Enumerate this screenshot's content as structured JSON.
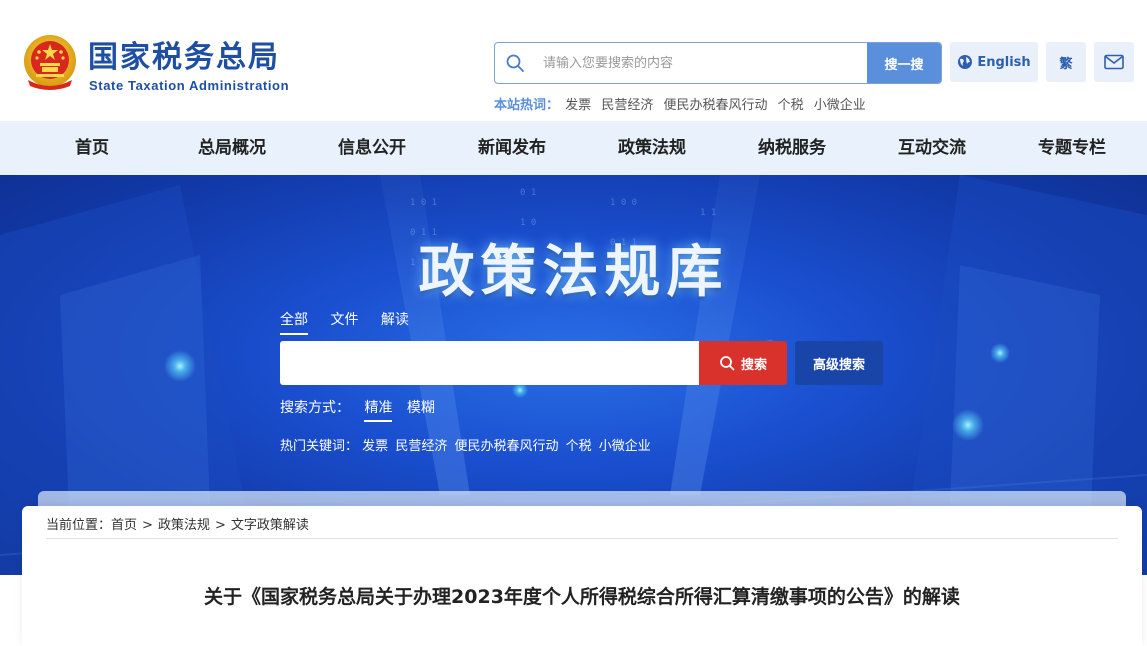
{
  "header": {
    "logo_cn": "国家税务总局",
    "logo_en": "State Taxation Administration",
    "search": {
      "placeholder": "请输入您要搜索的内容",
      "button": "搜一搜"
    },
    "english_label": "English",
    "traditional_label": "繁",
    "hot_label": "本站热词：",
    "hot_words": [
      "发票",
      "民营经济",
      "便民办税春风行动",
      "个税",
      "小微企业"
    ]
  },
  "nav": {
    "items": [
      "首页",
      "总局概况",
      "信息公开",
      "新闻发布",
      "政策法规",
      "纳税服务",
      "互动交流",
      "专题专栏"
    ]
  },
  "banner": {
    "title": "政策法规库",
    "tabs": [
      "全部",
      "文件",
      "解读"
    ],
    "search_button": "搜索",
    "advanced_button": "高级搜索",
    "mode_label": "搜索方式：",
    "modes": [
      "精准",
      "模糊"
    ],
    "hot_label": "热门关键词：",
    "hot_words": [
      "发票",
      "民营经济",
      "便民办税春风行动",
      "个税",
      "小微企业"
    ]
  },
  "content": {
    "breadcrumb_label": "当前位置：",
    "breadcrumb": [
      "首页",
      "政策法规",
      "文字政策解读"
    ],
    "breadcrumb_sep": ">",
    "article_title": "关于《国家税务总局关于办理2023年度个人所得税综合所得汇算清缴事项的公告》的解读"
  },
  "colors": {
    "brand_blue": "#1e4fa3",
    "nav_bg": "#e8f1fc",
    "search_btn": "#5a8fdc",
    "banner_search_btn": "#d9322d",
    "banner_adv_btn": "#1a45a8"
  }
}
